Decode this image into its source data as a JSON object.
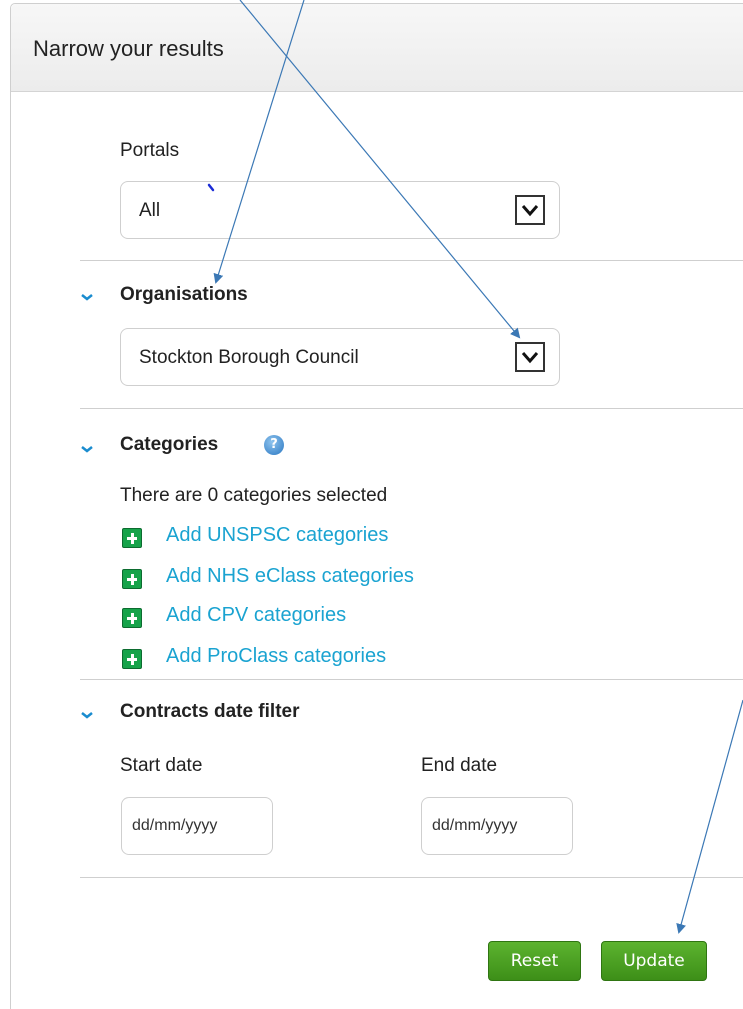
{
  "panel": {
    "title": "Narrow your results"
  },
  "portals": {
    "label": "Portals",
    "selected": "All"
  },
  "organisations": {
    "title": "Organisations",
    "selected": "Stockton Borough Council"
  },
  "categories": {
    "title": "Categories",
    "help_icon": "help-icon",
    "summary": "There are 0 categories selected",
    "links": [
      "Add UNSPSC categories",
      "Add NHS eClass categories",
      "Add CPV categories",
      "Add ProClass categories"
    ]
  },
  "date_filter": {
    "title": "Contracts date filter",
    "start_label": "Start date",
    "end_label": "End date",
    "start_placeholder": "dd/mm/yyyy",
    "end_placeholder": "dd/mm/yyyy"
  },
  "buttons": {
    "reset": "Reset",
    "update": "Update"
  },
  "colors": {
    "link": "#1aa3d1",
    "button_green": "#4aa021",
    "plus_icon_green": "#16a34a",
    "annotation_arrow": "#3b78b5"
  }
}
